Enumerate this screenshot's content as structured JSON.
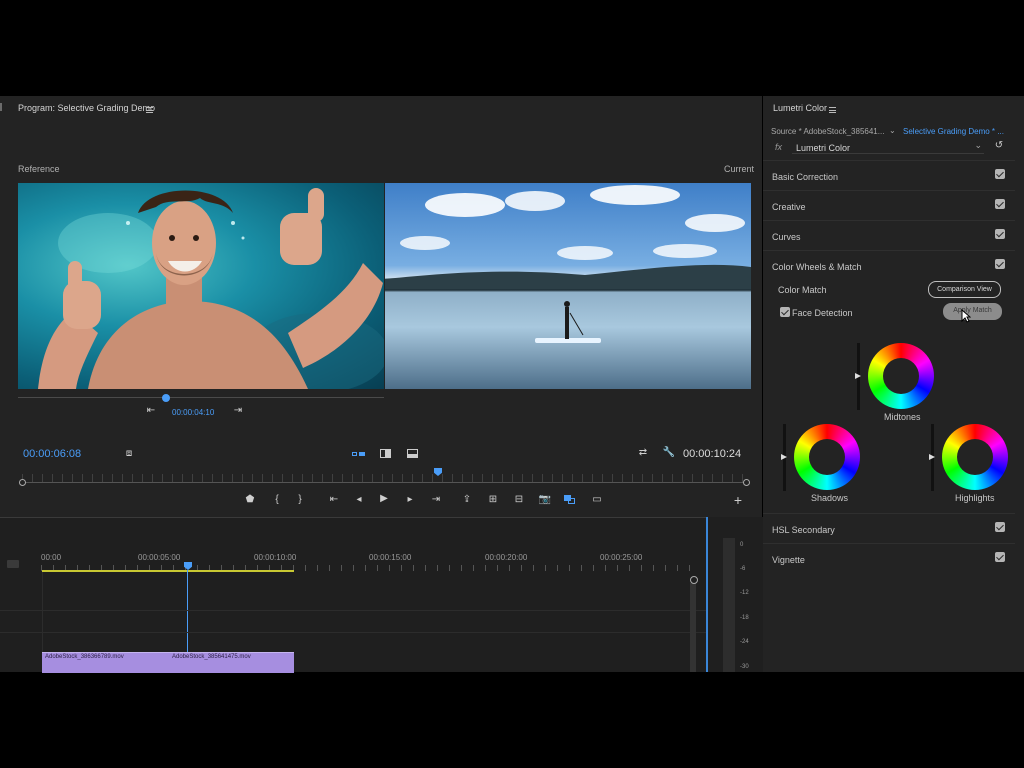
{
  "program": {
    "title": "Program: Selective Grading Demo",
    "reference_label": "Reference",
    "current_label": "Current",
    "ref_timecode": "00:00:04:10",
    "playhead_timecode": "00:00:06:08",
    "duration_timecode": "00:00:10:24"
  },
  "lumetri": {
    "title": "Lumetri Color",
    "source_label": "Source * AdobeStock_385641...",
    "sequence_label": "Selective Grading Demo * ...",
    "fx_label": "fx",
    "effect_name": "Lumetri Color",
    "sections": [
      {
        "label": "Basic Correction",
        "checked": true
      },
      {
        "label": "Creative",
        "checked": true
      },
      {
        "label": "Curves",
        "checked": true
      },
      {
        "label": "Color Wheels & Match",
        "checked": true
      }
    ],
    "color_match_label": "Color Match",
    "comparison_view_label": "Comparison View",
    "face_detection_label": "Face Detection",
    "apply_match_label": "Apply Match",
    "midtones_label": "Midtones",
    "shadows_label": "Shadows",
    "highlights_label": "Highlights",
    "hsl_label": "HSL Secondary",
    "vignette_label": "Vignette"
  },
  "timeline": {
    "ruler": [
      "00:00",
      "00:00:05:00",
      "00:00:10:00",
      "00:00:15:00",
      "00:00:20:00",
      "00:00:25:00"
    ],
    "clips": [
      "AdobeStock_386366789.mov",
      "AdobeStock_385641475.mov"
    ]
  },
  "meter": {
    "labels": [
      "0",
      "-6",
      "-12",
      "-18",
      "-24",
      "-30"
    ]
  },
  "colors": {
    "accent": "#4a9df8",
    "panel": "#232323",
    "clip": "#a68ee0"
  }
}
